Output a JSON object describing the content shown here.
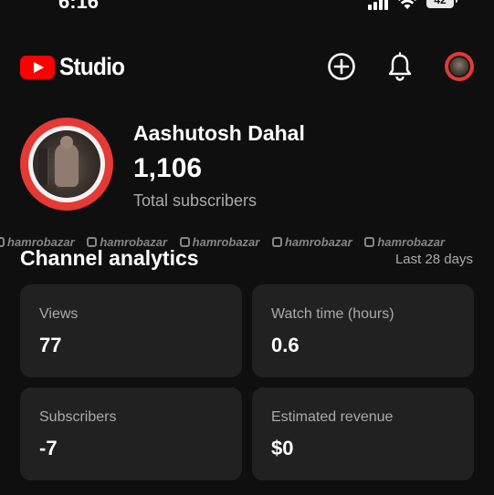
{
  "status_bar": {
    "time": "6:16",
    "battery": "42"
  },
  "header": {
    "logo_text": "Studio",
    "icons": {
      "create": "add-circle-icon",
      "notifications": "bell-icon"
    },
    "brand_color": "#ff0000"
  },
  "channel": {
    "name": "Aashutosh Dahal",
    "subscriber_count": "1,106",
    "subscriber_label": "Total subscribers"
  },
  "watermark": {
    "text": "hamrobazar",
    "repeat": 5
  },
  "analytics": {
    "title": "Channel analytics",
    "range": "Last 28 days",
    "cards": [
      {
        "label": "Views",
        "value": "77"
      },
      {
        "label": "Watch time (hours)",
        "value": "0.6"
      },
      {
        "label": "Subscribers",
        "value": "-7"
      },
      {
        "label": "Estimated revenue",
        "value": "$0"
      }
    ]
  }
}
